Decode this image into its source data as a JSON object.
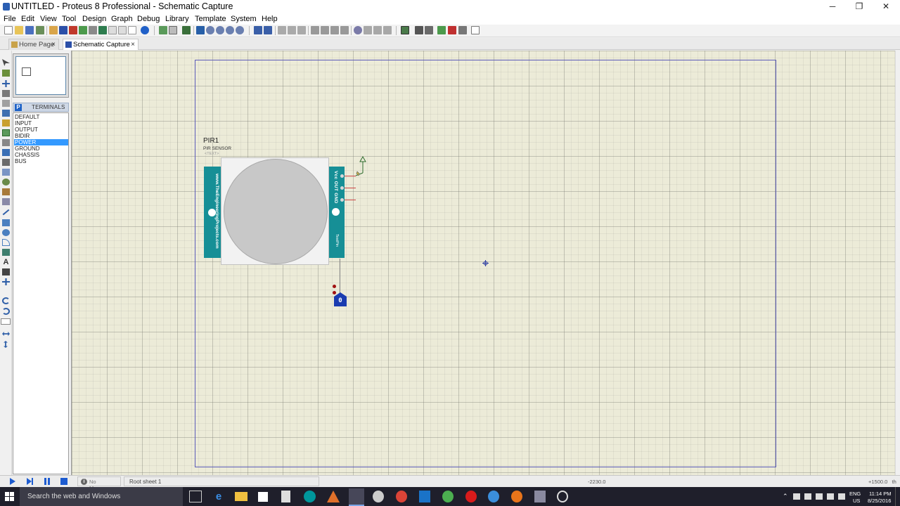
{
  "window": {
    "title": "UNTITLED - Proteus 8 Professional - Schematic Capture",
    "minimize_glyph": "─",
    "maximize_glyph": "❐",
    "close_glyph": "✕"
  },
  "menu": [
    "File",
    "Edit",
    "View",
    "Tool",
    "Design",
    "Graph",
    "Debug",
    "Library",
    "Template",
    "System",
    "Help"
  ],
  "tabs": [
    {
      "label": "Home Page",
      "active": false,
      "close": "×"
    },
    {
      "label": "Schematic Capture",
      "active": true,
      "close": "×"
    }
  ],
  "terminals": {
    "header_button": "P",
    "title": "TERMINALS",
    "items": [
      "DEFAULT",
      "INPUT",
      "OUTPUT",
      "BIDIR",
      "POWER",
      "GROUND",
      "CHASSIS",
      "BUS"
    ],
    "selected": "POWER"
  },
  "component": {
    "reference": "PIR1",
    "value": "PIR SENSOR",
    "text_placeholder": "<TEXT>",
    "left_strip_text": "www.TheEngineeringProjects.com",
    "pins_text": "Vcc OUT GND",
    "test_pin_text": "TestPin"
  },
  "logic_probe": {
    "value": "0"
  },
  "status": {
    "messages": "No Messages",
    "sheet": "Root sheet 1",
    "x_coord": "-2230.0",
    "y_coord": "+1500.0",
    "unit_suffix": "th"
  },
  "taskbar": {
    "search_placeholder": "Search the web and Windows",
    "language": "ENG",
    "region": "US",
    "time": "11:14 PM",
    "date": "8/25/2016"
  },
  "colors": {
    "canvas_bg": "#ecebd8",
    "sheet_border": "#5b5bb8",
    "pcb_teal": "#168f96",
    "selection_blue": "#3399ff",
    "probe_blue": "#1a3cb0",
    "taskbar_bg": "#1f1f2b"
  }
}
